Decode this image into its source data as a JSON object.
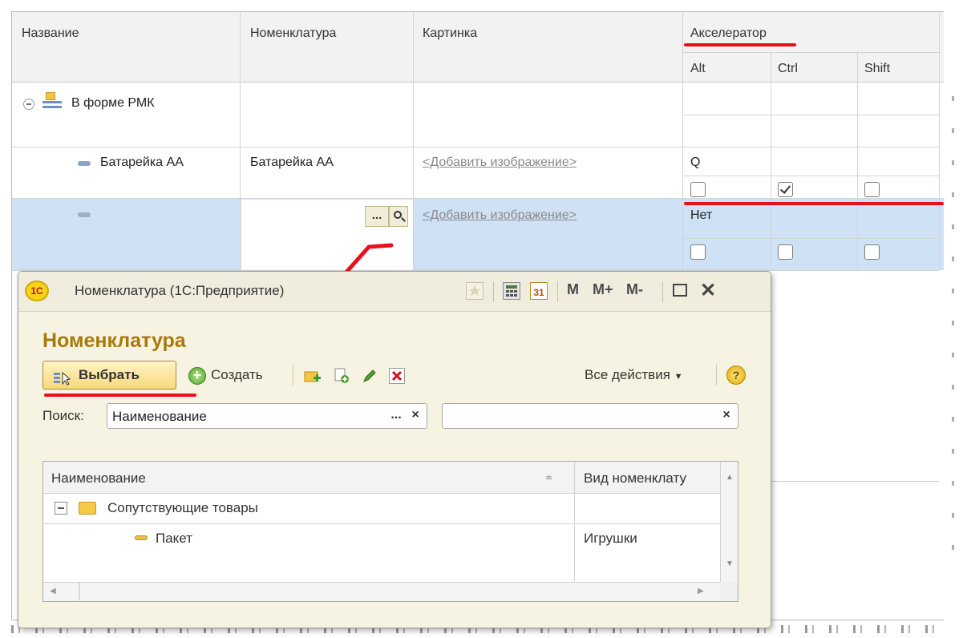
{
  "table": {
    "columns": {
      "name": "Название",
      "nomenclature": "Номенклатура",
      "picture": "Картинка",
      "accelerator": "Акселератор",
      "alt": "Alt",
      "ctrl": "Ctrl",
      "shift": "Shift"
    },
    "rows": [
      {
        "name": "В форме РМК",
        "nomenclature": "",
        "picture": "",
        "key": "",
        "alt": null,
        "ctrl": null,
        "shift": null
      },
      {
        "name": "Батарейка АА",
        "nomenclature": "Батарейка АА",
        "picture": "<Добавить изображение>",
        "key": "Q",
        "alt": false,
        "ctrl": true,
        "shift": false
      },
      {
        "name": "",
        "nomenclature": "",
        "picture": "<Добавить изображение>",
        "key": "Нет",
        "alt": false,
        "ctrl": false,
        "shift": false
      }
    ],
    "ellipsis_label": "...",
    "colors": {
      "selected_row": "#cfe1f5",
      "highlight": "#e8101a"
    }
  },
  "popup": {
    "window_title": "Номенклатура (1С:Предприятие)",
    "logo_text": "1С",
    "toolbar_icons": [
      "star-icon",
      "calculator-icon",
      "calendar-icon"
    ],
    "calendar_day": "31",
    "memory": {
      "m": "M",
      "m_plus": "M+",
      "m_minus": "M-"
    },
    "heading": "Номенклатура",
    "actions": {
      "select": "Выбрать",
      "create": "Создать",
      "all_actions": "Все действия",
      "help": "?"
    },
    "search": {
      "label": "Поиск:",
      "field_value": "Наименование",
      "ellipsis": "...",
      "clear": "×"
    },
    "list": {
      "headers": [
        "Наименование",
        "Вид номенклату"
      ],
      "rows": [
        {
          "name": "Сопутствующие товары",
          "kind": "",
          "type": "folder"
        },
        {
          "name": "Пакет",
          "kind": "Игрушки",
          "type": "item"
        }
      ]
    },
    "colors": {
      "heading": "#a8790b",
      "background": "#f7f3e2"
    }
  }
}
